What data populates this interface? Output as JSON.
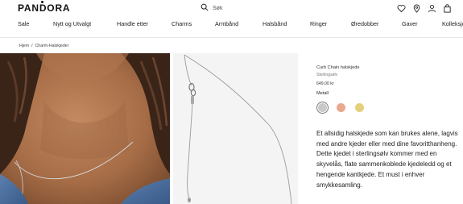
{
  "header": {
    "logo": "PANDORA",
    "search_placeholder": "Søk",
    "icons": [
      "heart-icon",
      "location-pin-icon",
      "user-icon",
      "shopping-bag-icon"
    ]
  },
  "nav": {
    "items": [
      "Sale",
      "Nytt og Utvalgt",
      "Handle etter",
      "Charms",
      "Armbånd",
      "Halsbånd",
      "Ringer",
      "Øredobber",
      "Gaver",
      "Kolleksjo"
    ]
  },
  "breadcrumb": {
    "items": [
      "Hjem",
      "/",
      "Charm-Halskjeder"
    ]
  },
  "product": {
    "name": "Curb Chain halskjede",
    "material": "Sterlingsølv",
    "price": "649,00 kr",
    "metal_label": "Metall",
    "swatches": [
      {
        "name": "silver",
        "color": "#c9c9c9",
        "selected": true
      },
      {
        "name": "rose-gold",
        "color": "#e8a98f",
        "selected": false
      },
      {
        "name": "gold",
        "color": "#e6cf7a",
        "selected": false
      }
    ],
    "description": "Et allsidig halskjede som kan brukes alene, lagvis med andre kjeder eller med dine favoritthanheng. Dette kjedet i sterlingsølv kommer med en skyvelås, flate sammenkoblede kjedeledd og et hengende kantkjede. Et must i enhver smykkesamling."
  },
  "colors": {
    "text": "#222222",
    "divider": "#e6e6e6",
    "image_bg": "#f4f4f4"
  }
}
